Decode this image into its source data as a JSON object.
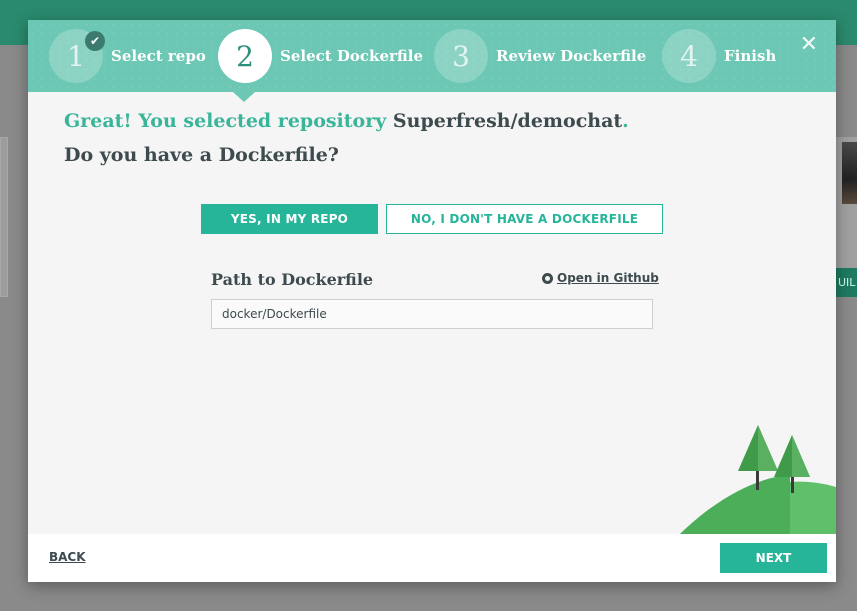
{
  "background": {
    "build_button_label": "UIL"
  },
  "wizard": {
    "steps": [
      {
        "number": "1",
        "label": "Select repo",
        "status": "complete",
        "badge_icon": "check-icon"
      },
      {
        "number": "2",
        "label": "Select Dockerfile",
        "status": "active"
      },
      {
        "number": "3",
        "label": "Review Dockerfile",
        "status": "pending"
      },
      {
        "number": "4",
        "label": "Finish",
        "status": "pending"
      }
    ],
    "close_icon": "close-icon",
    "close_glyph": "✕"
  },
  "content": {
    "headline_prefix": "Great! You selected repository ",
    "repository_name": "Superfresh/demochat",
    "headline_suffix": ".",
    "question": "Do you have a Dockerfile?",
    "yes_button": "YES, IN MY REPO",
    "no_button": "NO, I DON'T HAVE A DOCKERFILE",
    "selected_option": "YES, IN MY REPO",
    "path_label": "Path to Dockerfile",
    "github_link": "Open in Github",
    "github_icon": "github-icon",
    "path_value": "docker/Dockerfile"
  },
  "footer": {
    "back_label": "BACK",
    "next_label": "NEXT"
  },
  "colors": {
    "accent": "#26b599",
    "header_bg": "#6cc7b4",
    "headline_green": "#3ab59a",
    "text_dark": "#3d4a4e",
    "topbar": "#2a8a6d"
  }
}
